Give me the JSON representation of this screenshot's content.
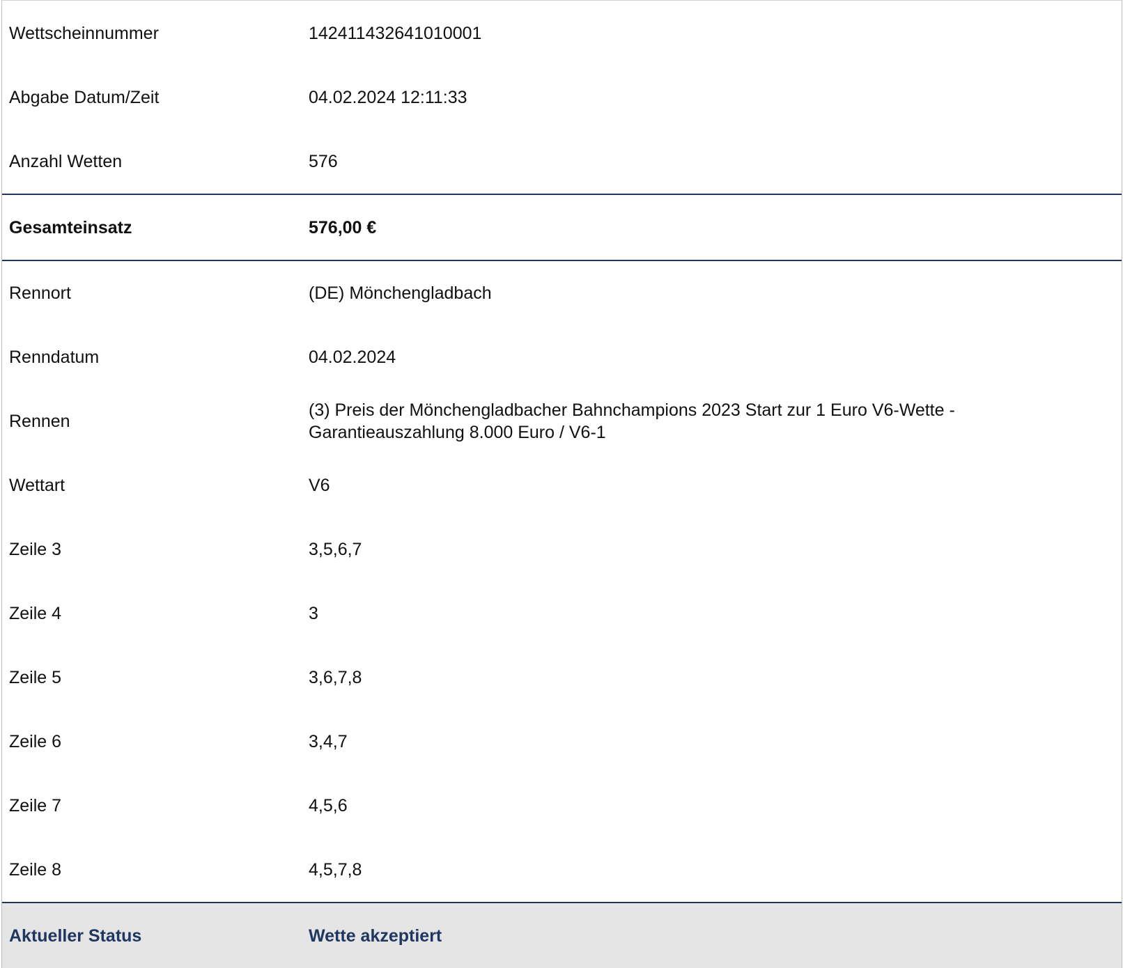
{
  "summary": {
    "ticket_number_label": "Wettscheinnummer",
    "ticket_number": "142411432641010001",
    "submitted_label": "Abgabe Datum/Zeit",
    "submitted": "04.02.2024 12:11:33",
    "bet_count_label": "Anzahl Wetten",
    "bet_count": "576"
  },
  "total": {
    "label": "Gesamteinsatz",
    "value": "576,00 €"
  },
  "details": {
    "venue_label": "Rennort",
    "venue": "(DE) Mönchengladbach",
    "race_date_label": "Renndatum",
    "race_date": "04.02.2024",
    "race_label": "Rennen",
    "race": "(3) Preis der Mönchengladbacher Bahnchampions 2023 Start zur 1 Euro V6-Wette - Garantieauszahlung 8.000 Euro / V6-1",
    "bet_type_label": "Wettart",
    "bet_type": "V6",
    "lines": [
      {
        "label": "Zeile 3",
        "value": "3,5,6,7"
      },
      {
        "label": "Zeile 4",
        "value": "3"
      },
      {
        "label": "Zeile 5",
        "value": "3,6,7,8"
      },
      {
        "label": "Zeile 6",
        "value": "3,4,7"
      },
      {
        "label": "Zeile 7",
        "value": "4,5,6"
      },
      {
        "label": "Zeile 8",
        "value": "4,5,7,8"
      }
    ]
  },
  "status": {
    "label": "Aktueller Status",
    "value": "Wette akzeptiert"
  },
  "colors": {
    "accent": "#1f3660",
    "status_background": "#e5e5e5"
  }
}
